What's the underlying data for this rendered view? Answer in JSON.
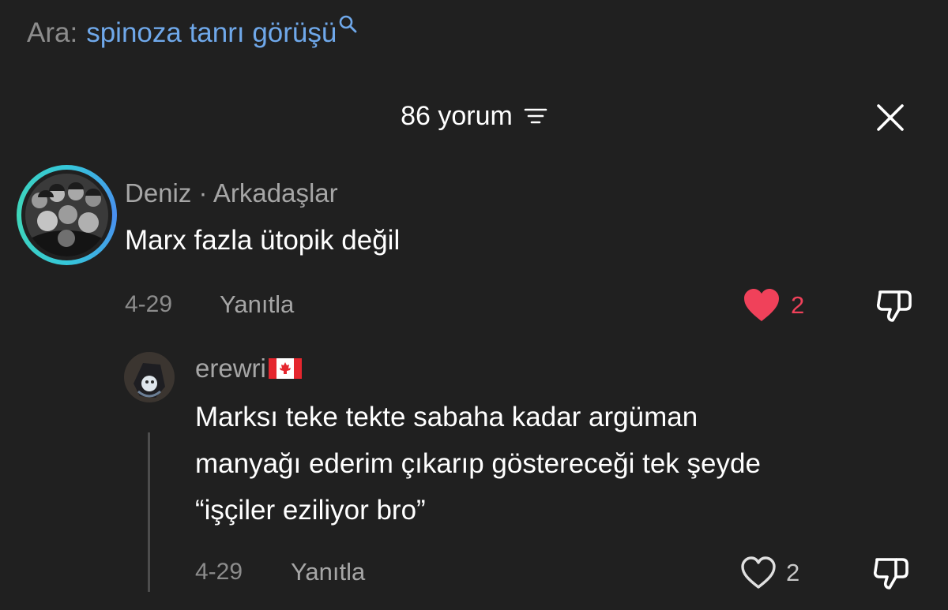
{
  "search": {
    "prefix": "Ara:",
    "query": "spinoza tanrı görüşü",
    "icon": "search-icon"
  },
  "header": {
    "count_label": "86 yorum",
    "sort_icon": "sort-icon",
    "close_icon": "close-icon"
  },
  "comment": {
    "avatar": "group-photo-avatar",
    "username": "Deniz",
    "separator": "·",
    "relation": "Arkadaşlar",
    "text": "Marx fazla ütopik değil",
    "date": "4-29",
    "reply_label": "Yanıtla",
    "like_count": "2",
    "liked": true,
    "like_color": "#f0415a",
    "dislike_icon": "thumbs-down-icon"
  },
  "reply": {
    "avatar": "cartoon-avatar",
    "username": "erewri",
    "flag": "canada-flag-icon",
    "text_lines": [
      "Marksı teke tekte sabaha kadar argüman",
      "manyağı ederim çıkarıp göstereceği tek şeyde",
      "“işçiler eziliyor bro”"
    ],
    "date": "4-29",
    "reply_label": "Yanıtla",
    "like_count": "2",
    "liked": false,
    "dislike_icon": "thumbs-down-icon"
  },
  "colors": {
    "background": "#202020",
    "accent_blue": "#6fa8ea",
    "muted_text": "#8c8c8c",
    "like_red": "#f0415a"
  }
}
